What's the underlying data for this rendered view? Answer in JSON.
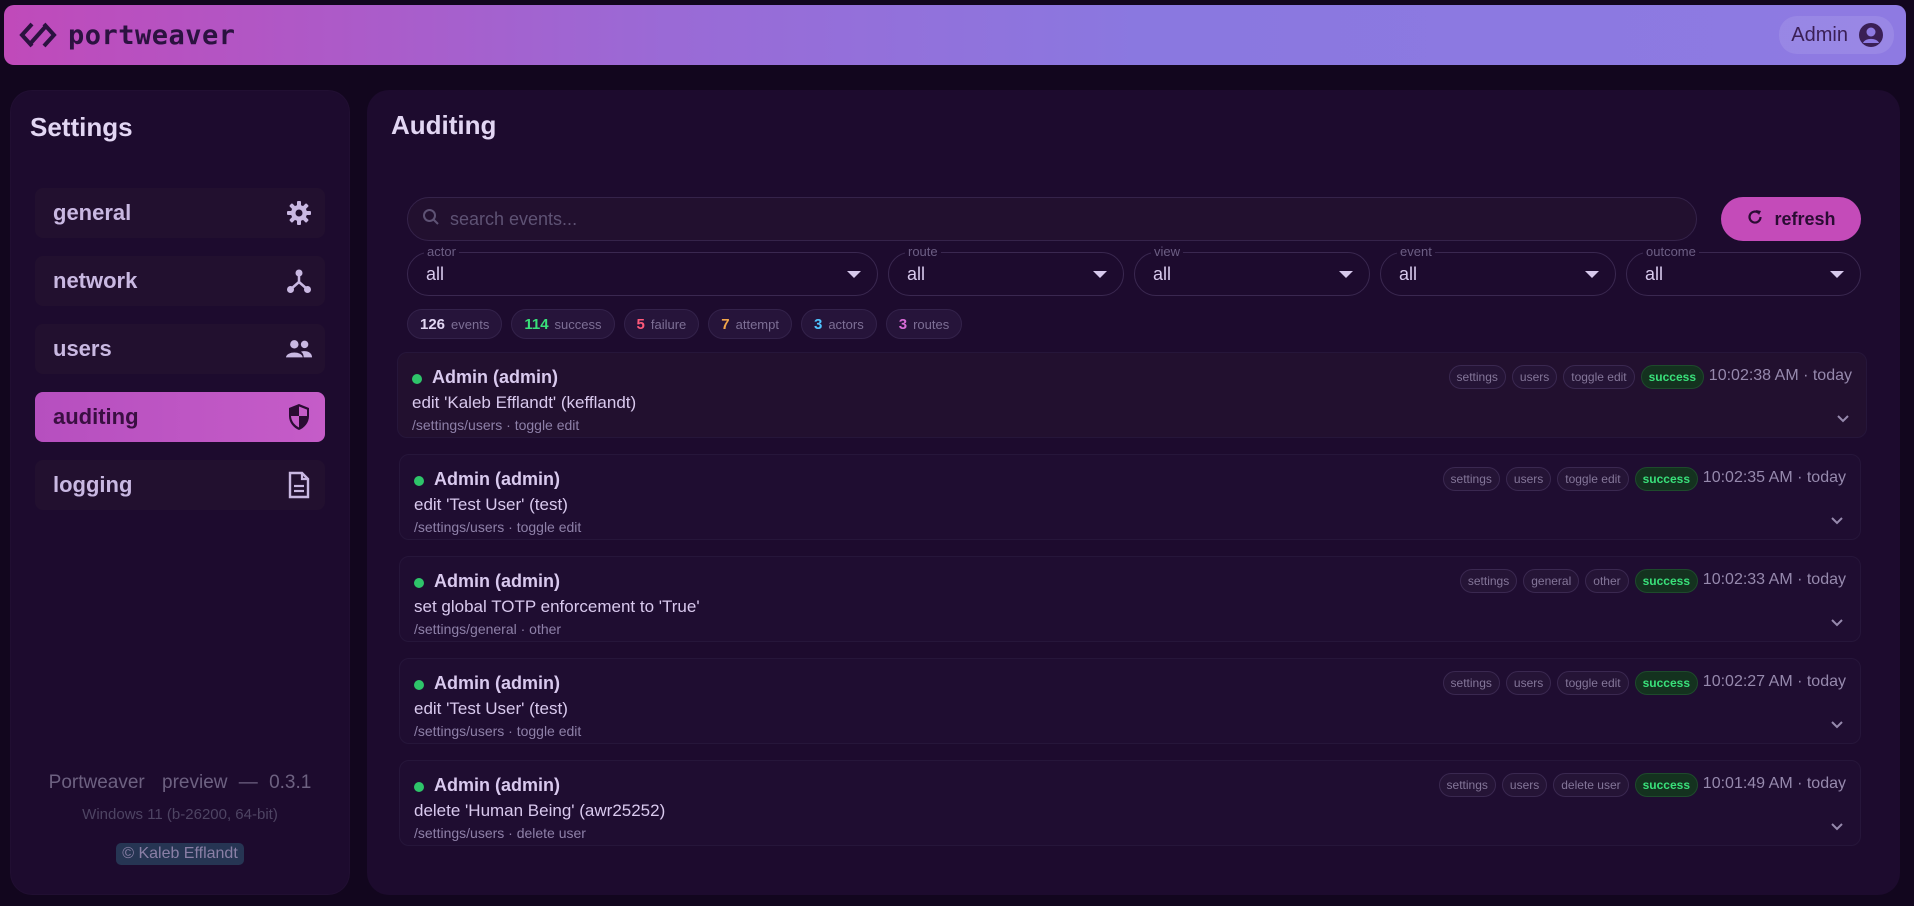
{
  "header": {
    "app_name": "portweaver",
    "user_label": "Admin",
    "gradient_colors": [
      "#c04aba",
      "#8a78e0"
    ]
  },
  "sidebar": {
    "title": "Settings",
    "items": [
      {
        "label": "general",
        "icon": "gear-icon",
        "active": false
      },
      {
        "label": "network",
        "icon": "network-icon",
        "active": false
      },
      {
        "label": "users",
        "icon": "users-icon",
        "active": false
      },
      {
        "label": "auditing",
        "icon": "shield-icon",
        "active": true
      },
      {
        "label": "logging",
        "icon": "document-icon",
        "active": false
      }
    ],
    "footer": {
      "app": "Portweaver",
      "channel": "preview",
      "separator": "—",
      "version": "0.3.1",
      "os": "Windows 11 (b-26200, 64-bit)",
      "copyright": "© Kaleb Efflandt"
    }
  },
  "main": {
    "title": "Auditing",
    "search": {
      "placeholder": "search events..."
    },
    "refresh_label": "refresh",
    "filters": [
      {
        "legend": "actor",
        "value": "all"
      },
      {
        "legend": "route",
        "value": "all"
      },
      {
        "legend": "view",
        "value": "all"
      },
      {
        "legend": "event",
        "value": "all"
      },
      {
        "legend": "outcome",
        "value": "all"
      }
    ],
    "stats": [
      {
        "num": "126",
        "label": "events",
        "color": "#e2d6f3"
      },
      {
        "num": "114",
        "label": "success",
        "color": "#39e07a"
      },
      {
        "num": "5",
        "label": "failure",
        "color": "#ff5a7a"
      },
      {
        "num": "7",
        "label": "attempt",
        "color": "#f2a64a"
      },
      {
        "num": "3",
        "label": "actors",
        "color": "#4fc3ff"
      },
      {
        "num": "3",
        "label": "routes",
        "color": "#d76bd6"
      }
    ],
    "events": [
      {
        "actor": "Admin (admin)",
        "desc": "edit 'Kaleb Efflandt' (kefflandt)",
        "path": "/settings/users · toggle edit",
        "tags": [
          "settings",
          "users",
          "toggle edit"
        ],
        "outcome": "success",
        "time": "10:02:38 AM · today"
      },
      {
        "actor": "Admin (admin)",
        "desc": "edit 'Test User' (test)",
        "path": "/settings/users · toggle edit",
        "tags": [
          "settings",
          "users",
          "toggle edit"
        ],
        "outcome": "success",
        "time": "10:02:35 AM · today"
      },
      {
        "actor": "Admin (admin)",
        "desc": "set global TOTP enforcement to 'True'",
        "path": "/settings/general · other",
        "tags": [
          "settings",
          "general",
          "other"
        ],
        "outcome": "success",
        "time": "10:02:33 AM · today"
      },
      {
        "actor": "Admin (admin)",
        "desc": "edit 'Test User' (test)",
        "path": "/settings/users · toggle edit",
        "tags": [
          "settings",
          "users",
          "toggle edit"
        ],
        "outcome": "success",
        "time": "10:02:27 AM · today"
      },
      {
        "actor": "Admin (admin)",
        "desc": "delete 'Human Being' (awr25252)",
        "path": "/settings/users · delete user",
        "tags": [
          "settings",
          "users",
          "delete user"
        ],
        "outcome": "success",
        "time": "10:01:49 AM · today"
      }
    ]
  }
}
